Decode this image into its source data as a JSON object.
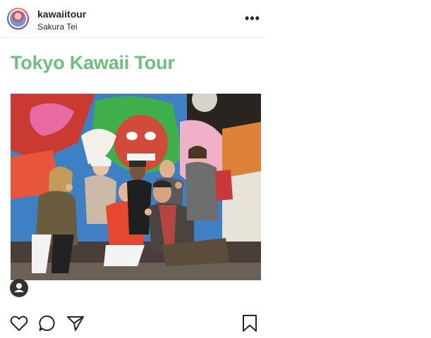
{
  "post": {
    "username": "kawaiitour",
    "location": "Sakura Tei",
    "more_label": "•••",
    "banner_title": "Tokyo Kawaii Tour"
  },
  "icons": {
    "avatar": "profile-avatar",
    "more": "more-options-icon",
    "tagged_user": "tagged-user-icon",
    "like": "heart-icon",
    "comment": "comment-icon",
    "share": "paper-plane-icon",
    "save": "bookmark-icon"
  },
  "colors": {
    "banner_text": "#6dbf7b",
    "text": "#262626"
  }
}
